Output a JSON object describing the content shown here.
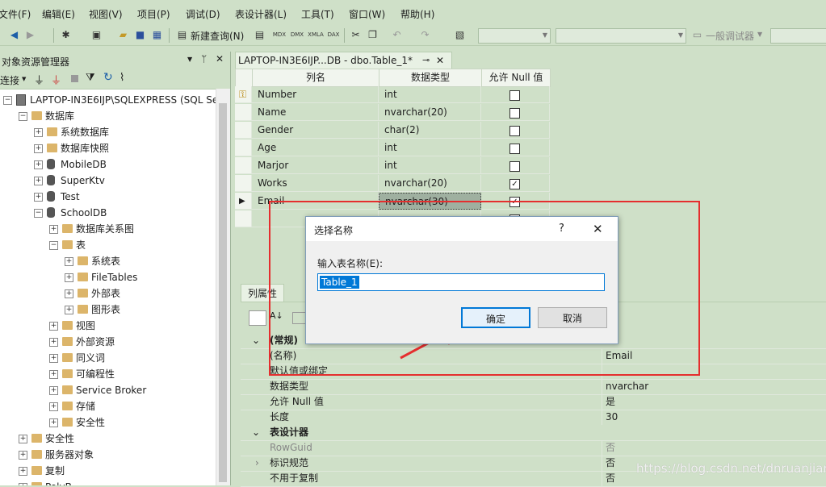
{
  "menu": [
    "文件(F)",
    "编辑(E)",
    "视图(V)",
    "项目(P)",
    "调试(D)",
    "表设计器(L)",
    "工具(T)",
    "窗口(W)",
    "帮助(H)"
  ],
  "toolbar": {
    "new_query": "新建查询(N)",
    "debugger_combo": "一般调试器",
    "icon_labels": [
      "MDX",
      "DMX",
      "XMLA",
      "DAX"
    ]
  },
  "object_explorer": {
    "title": "对象资源管理器",
    "connect_label": "连接",
    "tree": [
      {
        "label": "LAPTOP-IN3E6IJP\\SQLEXPRESS (SQL Se",
        "icon": "server-icon",
        "exp": "−"
      },
      {
        "label": "数据库",
        "icon": "folder-icon",
        "exp": "−"
      },
      {
        "label": "系统数据库",
        "icon": "folder-icon",
        "exp": "+"
      },
      {
        "label": "数据库快照",
        "icon": "folder-icon",
        "exp": "+"
      },
      {
        "label": "MobileDB",
        "icon": "database-icon",
        "exp": "+"
      },
      {
        "label": "SuperKtv",
        "icon": "database-icon",
        "exp": "+"
      },
      {
        "label": "Test",
        "icon": "database-icon",
        "exp": "+"
      },
      {
        "label": "SchoolDB",
        "icon": "database-icon",
        "exp": "−"
      },
      {
        "label": "数据库关系图",
        "icon": "folder-icon",
        "exp": "+"
      },
      {
        "label": "表",
        "icon": "folder-icon",
        "exp": "−"
      },
      {
        "label": "系统表",
        "icon": "folder-icon",
        "exp": "+"
      },
      {
        "label": "FileTables",
        "icon": "folder-icon",
        "exp": "+"
      },
      {
        "label": "外部表",
        "icon": "folder-icon",
        "exp": "+"
      },
      {
        "label": "图形表",
        "icon": "folder-icon",
        "exp": "+"
      },
      {
        "label": "视图",
        "icon": "folder-icon",
        "exp": "+"
      },
      {
        "label": "外部资源",
        "icon": "folder-icon",
        "exp": "+"
      },
      {
        "label": "同义词",
        "icon": "folder-icon",
        "exp": "+"
      },
      {
        "label": "可编程性",
        "icon": "folder-icon",
        "exp": "+"
      },
      {
        "label": "Service Broker",
        "icon": "folder-icon",
        "exp": "+"
      },
      {
        "label": "存储",
        "icon": "folder-icon",
        "exp": "+"
      },
      {
        "label": "安全性",
        "icon": "folder-icon",
        "exp": "+"
      },
      {
        "label": "安全性",
        "icon": "folder-icon",
        "exp": "+"
      },
      {
        "label": "服务器对象",
        "icon": "folder-icon",
        "exp": "+"
      },
      {
        "label": "复制",
        "icon": "folder-icon",
        "exp": "+"
      },
      {
        "label": "PolyB",
        "icon": "folder-icon",
        "exp": "+"
      }
    ]
  },
  "document": {
    "tab_label": "LAPTOP-IN3E6IJP...DB - dbo.Table_1*",
    "columns_header": [
      "列名",
      "数据类型",
      "允许 Null 值"
    ],
    "rows": [
      {
        "name": "Number",
        "type": "int",
        "nullable": false,
        "key": true
      },
      {
        "name": "Name",
        "type": "nvarchar(20)",
        "nullable": false,
        "key": false
      },
      {
        "name": "Gender",
        "type": "char(2)",
        "nullable": false,
        "key": false
      },
      {
        "name": "Age",
        "type": "int",
        "nullable": false,
        "key": false
      },
      {
        "name": "Marjor",
        "type": "int",
        "nullable": false,
        "key": false
      },
      {
        "name": "Works",
        "type": "nvarchar(20)",
        "nullable": true,
        "key": false
      },
      {
        "name": "Email",
        "type": "nvarchar(30)",
        "nullable": true,
        "key": false,
        "current": true
      },
      {
        "name": "",
        "type": "",
        "nullable": true,
        "key": false
      }
    ]
  },
  "properties": {
    "tab_label": "列属性",
    "rows": [
      {
        "kind": "section",
        "label": "(常规)"
      },
      {
        "label": "(名称)",
        "value": "Email"
      },
      {
        "label": "默认值或绑定",
        "value": ""
      },
      {
        "label": "数据类型",
        "value": "nvarchar"
      },
      {
        "label": "允许 Null 值",
        "value": "是"
      },
      {
        "label": "长度",
        "value": "30"
      },
      {
        "kind": "section",
        "label": "表设计器"
      },
      {
        "label": "RowGuid",
        "value": "否",
        "disabled": true
      },
      {
        "label": "标识规范",
        "value": "否",
        "expandable": true
      },
      {
        "label": "不用于复制",
        "value": "否"
      }
    ]
  },
  "dialog": {
    "title": "选择名称",
    "help": "?",
    "close": "✕",
    "prompt": "输入表名称(E):",
    "value": "Table_1",
    "ok": "确定",
    "cancel": "取消"
  },
  "watermark": "https://blog.csdn.net/dnruanjian",
  "colors": {
    "accent": "#0078d7",
    "annotation": "#e52e2e",
    "panel": "#cfe0c8"
  }
}
